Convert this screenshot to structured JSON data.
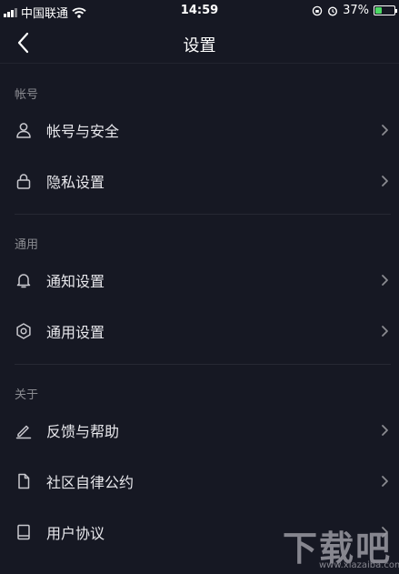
{
  "status_bar": {
    "carrier": "中国联通",
    "time": "14:59",
    "battery_percent": "37%",
    "battery_level": 0.37
  },
  "nav": {
    "title": "设置"
  },
  "sections": {
    "account": {
      "label": "帐号",
      "items": [
        {
          "label": "帐号与安全",
          "icon": "user-icon"
        },
        {
          "label": "隐私设置",
          "icon": "lock-icon"
        }
      ]
    },
    "general": {
      "label": "通用",
      "items": [
        {
          "label": "通知设置",
          "icon": "bell-icon"
        },
        {
          "label": "通用设置",
          "icon": "gear-icon"
        }
      ]
    },
    "about": {
      "label": "关于",
      "items": [
        {
          "label": "反馈与帮助",
          "icon": "pencil-icon"
        },
        {
          "label": "社区自律公约",
          "icon": "document-icon"
        },
        {
          "label": "用户协议",
          "icon": "book-icon"
        }
      ]
    }
  },
  "watermark": {
    "text": "下载吧",
    "url": "www.xiazaiba.com"
  },
  "colors": {
    "background": "#161823",
    "text": "#e8e8ec",
    "muted": "#8a8b91",
    "battery": "#4cd964"
  }
}
